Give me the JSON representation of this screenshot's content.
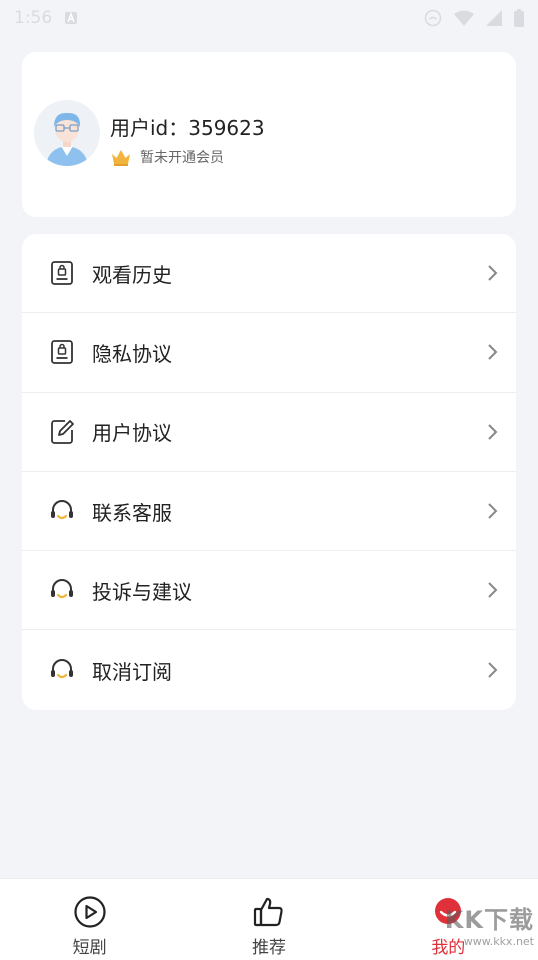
{
  "status_bar": {
    "time": "1:56",
    "left_icon": "a-notification-icon",
    "right_icons": [
      "face-icon",
      "wifi-icon",
      "signal-icon",
      "battery-icon"
    ]
  },
  "profile": {
    "user_id": "用户id：359623",
    "vip_status": "暂未开通会员",
    "avatar_icon": "avatar-icon",
    "crown_icon": "crown-icon"
  },
  "menu": {
    "items": [
      {
        "label": "观看历史",
        "icon": "history-doc-icon"
      },
      {
        "label": "隐私协议",
        "icon": "privacy-doc-icon"
      },
      {
        "label": "用户协议",
        "icon": "edit-doc-icon"
      },
      {
        "label": "联系客服",
        "icon": "headset-icon"
      },
      {
        "label": "投诉与建议",
        "icon": "headset-icon"
      },
      {
        "label": "取消订阅",
        "icon": "headset-icon"
      }
    ]
  },
  "tabbar": {
    "tabs": [
      {
        "label": "短剧",
        "icon": "play-circle-icon"
      },
      {
        "label": "推荐",
        "icon": "thumbs-up-icon"
      },
      {
        "label": "我的",
        "icon": "profile-face-icon",
        "active": true
      }
    ]
  },
  "watermark": {
    "big": "KK下载",
    "small": "www.kkx.net"
  },
  "colors": {
    "accent": "#e0303a",
    "background": "#f3f4f8",
    "card": "#ffffff",
    "crown": "#f2b43c",
    "headset_accent": "#f2b43c"
  }
}
